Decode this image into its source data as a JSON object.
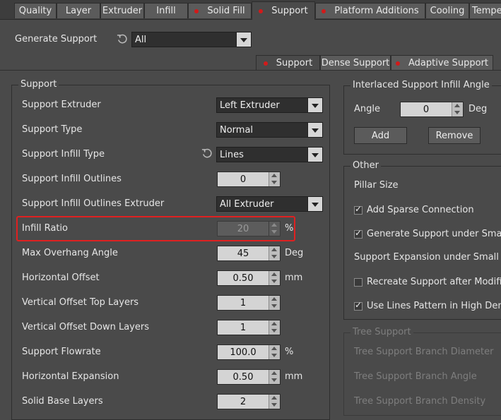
{
  "tabs": [
    "Quality",
    "Layer",
    "Extruder",
    "Infill",
    "Solid Fill",
    "Support",
    "Platform Additions",
    "Cooling",
    "Tempe"
  ],
  "generate_support": {
    "label": "Generate Support",
    "value": "All"
  },
  "subtabs": [
    "Support",
    "Dense Support",
    "Adaptive Support"
  ],
  "support_group": {
    "title": "Support",
    "rows": [
      {
        "label": "Support Extruder",
        "value": "Left Extruder"
      },
      {
        "label": "Support Type",
        "value": "Normal"
      },
      {
        "label": "Support Infill Type",
        "value": "Lines"
      },
      {
        "label": "Support Infill Outlines",
        "value": "0"
      },
      {
        "label": "Support Infill Outlines Extruder",
        "value": "All Extruder"
      },
      {
        "label": "Infill Ratio",
        "value": "20",
        "unit": "%"
      },
      {
        "label": "Max Overhang Angle",
        "value": "45",
        "unit": "Deg"
      },
      {
        "label": "Horizontal Offset",
        "value": "0.50",
        "unit": "mm"
      },
      {
        "label": "Vertical Offset Top Layers",
        "value": "1"
      },
      {
        "label": "Vertical Offset Down Layers",
        "value": "1"
      },
      {
        "label": "Support Flowrate",
        "value": "100.0",
        "unit": "%"
      },
      {
        "label": "Horizontal Expansion",
        "value": "0.50",
        "unit": "mm"
      },
      {
        "label": "Solid Base Layers",
        "value": "2"
      }
    ]
  },
  "interlaced": {
    "title": "Interlaced Support Infill Angle",
    "angle_label": "Angle",
    "angle_value": "0",
    "angle_unit": "Deg",
    "add": "Add",
    "remove": "Remove"
  },
  "other": {
    "title": "Other",
    "pillar": "Pillar Size",
    "add_sparse": "Add Sparse Connection",
    "gen_small": "Generate Support under Small F",
    "expansion": "Support Expansion under Small Flo",
    "recreate": "Recreate Support after Modifier",
    "lines_pattern": "Use Lines Pattern in High Densit"
  },
  "tree": {
    "title": "Tree Support",
    "diameter": "Tree Support Branch Diameter",
    "angle": "Tree Support Branch Angle",
    "density": "Tree Support Branch Density"
  },
  "colors": {
    "highlight": "#e02020",
    "dot": "#d21a1a"
  }
}
